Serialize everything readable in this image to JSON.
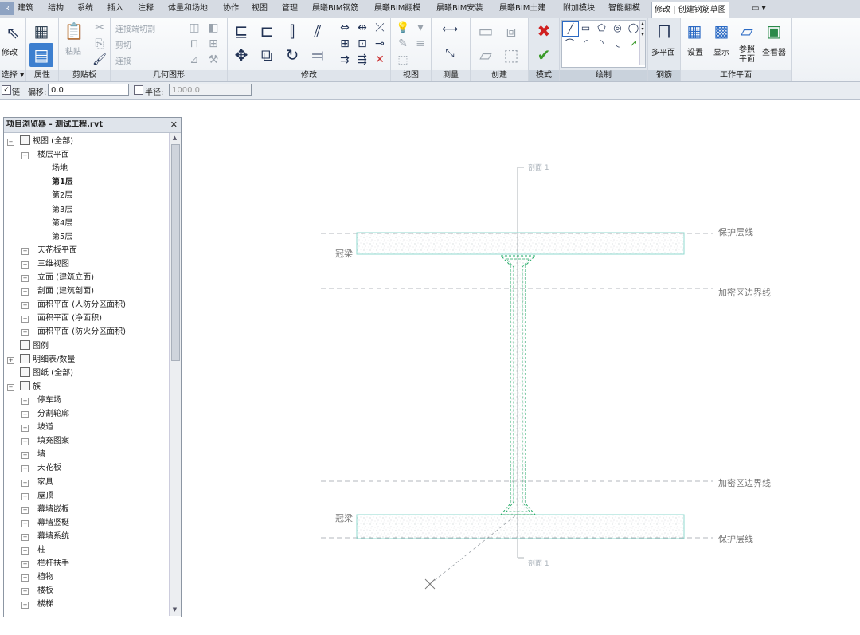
{
  "menu": {
    "items": [
      "建筑",
      "结构",
      "系统",
      "插入",
      "注释",
      "体量和场地",
      "协作",
      "视图",
      "管理",
      "晨曦BIM钢筋",
      "晨曦BIM翻模",
      "晨曦BIM安装",
      "晨曦BIM土建",
      "附加模块",
      "智能翻模"
    ],
    "active_tab": "修改 | 创建钢筋草图",
    "extra": "▭ ▾"
  },
  "ribbon": {
    "select": {
      "modify_label": "修改",
      "select_label": "选择 ▾"
    },
    "properties": {
      "label": "属性"
    },
    "clipboard": {
      "label": "剪贴板",
      "paste_label": "粘贴"
    },
    "geometry": {
      "label": "几何图形",
      "cut_join": "连接端切割",
      "cut": "剪切",
      "join": "连接"
    },
    "modify": {
      "label": "修改"
    },
    "view": {
      "label": "视图"
    },
    "measure": {
      "label": "测量"
    },
    "create": {
      "label": "创建"
    },
    "mode": {
      "label": "模式"
    },
    "draw": {
      "label": "绘制"
    },
    "rebar": {
      "label": "钢筋",
      "multiplane": "多平面"
    },
    "workplane": {
      "label": "工作平面",
      "set": "设置",
      "show": "显示",
      "ref_plane": "参照\n平面",
      "viewer": "查看器"
    }
  },
  "options": {
    "chain_label": "链",
    "offset_label": "偏移:",
    "offset_value": "0.0",
    "radius_label": "半径:",
    "radius_value": "1000.0"
  },
  "browser": {
    "title": "项目浏览器 - 测试工程.rvt",
    "close": "✕",
    "nodes": [
      {
        "label": "视图 (全部)",
        "level": 0,
        "toggle": "−",
        "icon": "view"
      },
      {
        "label": "楼层平面",
        "level": 1,
        "toggle": "−"
      },
      {
        "label": "场地",
        "level": 2
      },
      {
        "label": "第1层",
        "level": 2,
        "bold": true
      },
      {
        "label": "第2层",
        "level": 2
      },
      {
        "label": "第3层",
        "level": 2
      },
      {
        "label": "第4层",
        "level": 2
      },
      {
        "label": "第5层",
        "level": 2
      },
      {
        "label": "天花板平面",
        "level": 1,
        "toggle": "+"
      },
      {
        "label": "三维视图",
        "level": 1,
        "toggle": "+"
      },
      {
        "label": "立面 (建筑立面)",
        "level": 1,
        "toggle": "+"
      },
      {
        "label": "剖面 (建筑剖面)",
        "level": 1,
        "toggle": "+"
      },
      {
        "label": "面积平面 (人防分区面积)",
        "level": 1,
        "toggle": "+"
      },
      {
        "label": "面积平面 (净面积)",
        "level": 1,
        "toggle": "+"
      },
      {
        "label": "面积平面 (防火分区面积)",
        "level": 1,
        "toggle": "+"
      },
      {
        "label": "图例",
        "level": 0,
        "icon": "legend"
      },
      {
        "label": "明细表/数量",
        "level": 0,
        "toggle": "+",
        "icon": "table"
      },
      {
        "label": "图纸 (全部)",
        "level": 0,
        "icon": "sheet"
      },
      {
        "label": "族",
        "level": 0,
        "toggle": "−",
        "icon": "family"
      },
      {
        "label": "停车场",
        "level": 1,
        "toggle": "+"
      },
      {
        "label": "分割轮廓",
        "level": 1,
        "toggle": "+"
      },
      {
        "label": "坡道",
        "level": 1,
        "toggle": "+"
      },
      {
        "label": "填充图案",
        "level": 1,
        "toggle": "+"
      },
      {
        "label": "墙",
        "level": 1,
        "toggle": "+"
      },
      {
        "label": "天花板",
        "level": 1,
        "toggle": "+"
      },
      {
        "label": "家具",
        "level": 1,
        "toggle": "+"
      },
      {
        "label": "屋顶",
        "level": 1,
        "toggle": "+"
      },
      {
        "label": "幕墙嵌板",
        "level": 1,
        "toggle": "+"
      },
      {
        "label": "幕墙竖梃",
        "level": 1,
        "toggle": "+"
      },
      {
        "label": "幕墙系统",
        "level": 1,
        "toggle": "+"
      },
      {
        "label": "柱",
        "level": 1,
        "toggle": "+"
      },
      {
        "label": "栏杆扶手",
        "level": 1,
        "toggle": "+"
      },
      {
        "label": "植物",
        "level": 1,
        "toggle": "+"
      },
      {
        "label": "楼板",
        "level": 1,
        "toggle": "+"
      },
      {
        "label": "楼梯",
        "level": 1,
        "toggle": "+"
      }
    ]
  },
  "drawing": {
    "section_top": "剖面 1",
    "section_bottom": "剖面 1",
    "crown_beam_top": "冠梁",
    "crown_beam_bottom": "冠梁",
    "cover_line_top": "保护层线",
    "cover_line_bottom": "保护层线",
    "dense_zone_top": "加密区边界线",
    "dense_zone_bottom": "加密区边界线",
    "colors": {
      "rebar": "#22aa66",
      "beam": "#8fd9cf",
      "dashed": "#9aa0a6",
      "text": "#777777"
    }
  }
}
